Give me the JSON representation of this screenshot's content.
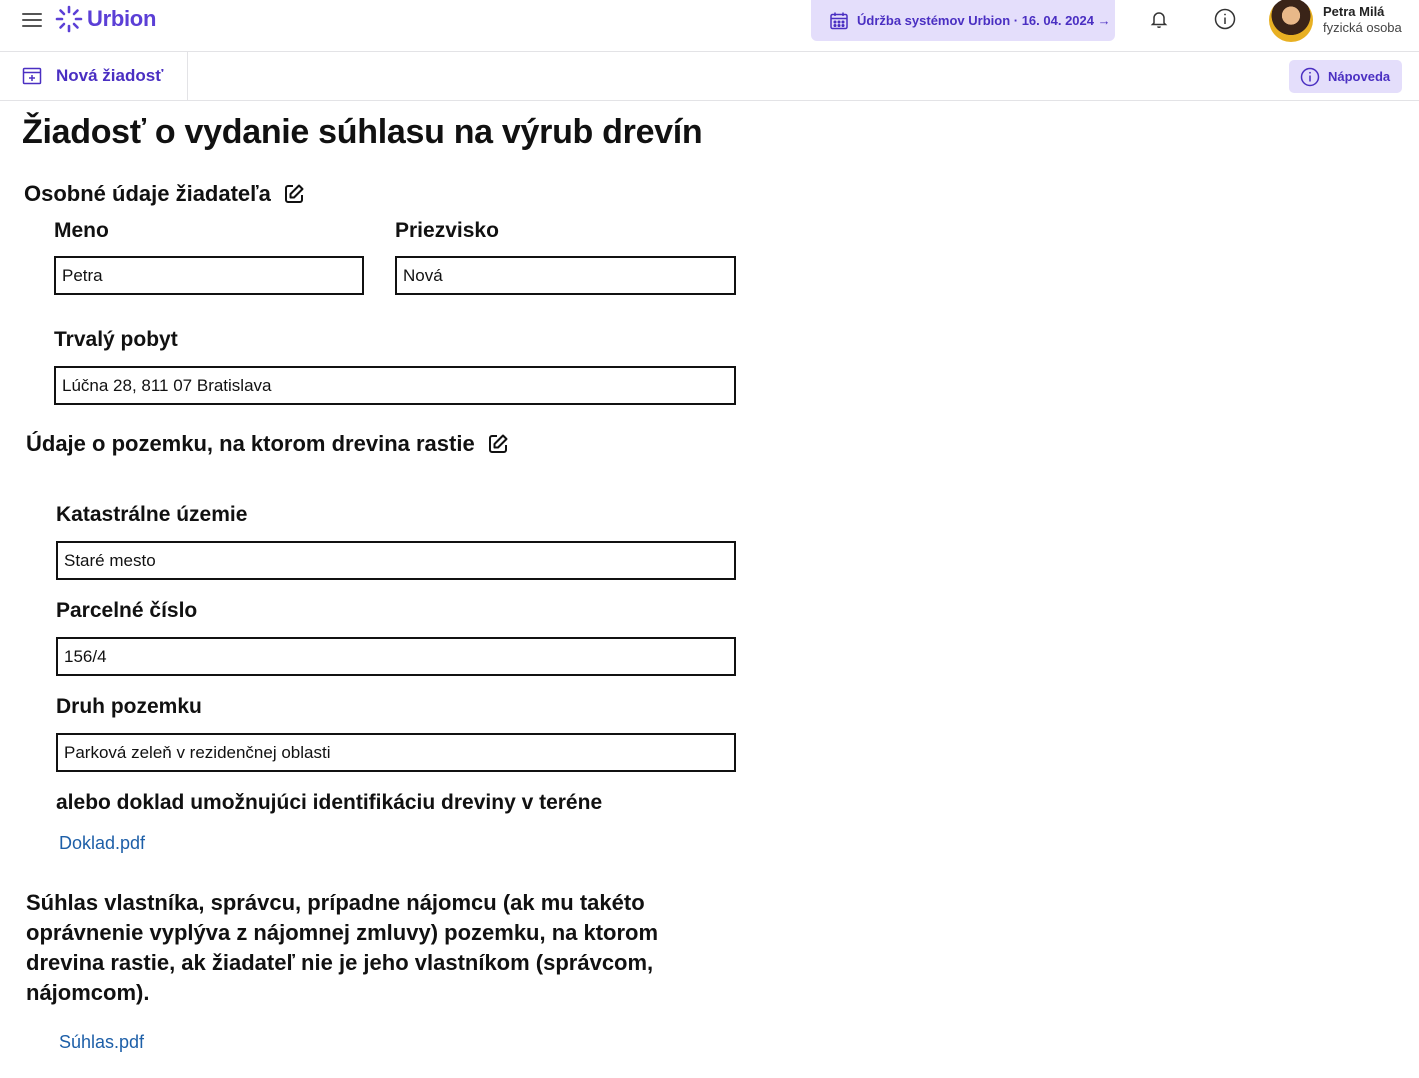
{
  "app": {
    "name": "Urbion"
  },
  "header": {
    "maintenance_text": "Údržba systémov Urbion · 16. 04. 2024 →",
    "user_name": "Petra Milá",
    "user_role": "fyzická osoba"
  },
  "subnav": {
    "new_request": "Nová žiadosť",
    "help": "Nápoveda"
  },
  "page_title": "Žiadosť o vydanie súhlasu na výrub drevín",
  "applicant": {
    "title": "Osobné údaje žiadateľa",
    "first_name_label": "Meno",
    "first_name_value": "Petra",
    "last_name_label": "Priezvisko",
    "last_name_value": "Nová",
    "address_label": "Trvalý pobyt",
    "address_value": "Lúčna 28, 811 07 Bratislava"
  },
  "land": {
    "title": "Údaje o pozemku, na ktorom drevina rastie",
    "cadastre_label": "Katastrálne územie",
    "cadastre_value": "Staré mesto",
    "parcel_label": "Parcelné číslo",
    "parcel_value": "156/4",
    "type_label": "Druh pozemku",
    "type_value": "Parková zeleň v rezidenčnej oblasti",
    "doc_label": "alebo doklad umožnujúci identifikáciu dreviny v teréne",
    "doc_file": "Doklad.pdf"
  },
  "consent": {
    "text": "Súhlas vlastníka, správcu, prípadne nájomcu (ak mu takéto oprávnenie vyplýva  z nájomnej zmluvy) pozemku, na ktorom drevina rastie, ak žiadateľ nie je jeho vlastníkom (správcom, nájomcom).",
    "file": "Súhlas.pdf"
  },
  "colors": {
    "accent": "#5b3fd6",
    "accent_bg": "#e4defb",
    "link": "#1d5fa8"
  },
  "icons": [
    "menu-icon",
    "logo-icon",
    "calendar-icon",
    "bell-icon",
    "info-icon",
    "new-form-icon",
    "edit-icon"
  ]
}
